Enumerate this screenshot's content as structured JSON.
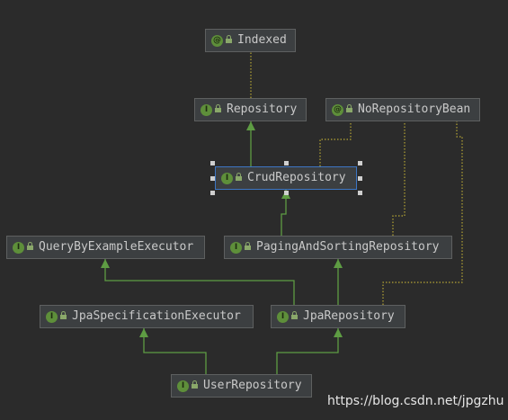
{
  "nodes": {
    "indexed": {
      "label": "Indexed",
      "kind": "@"
    },
    "repository": {
      "label": "Repository",
      "kind": "I"
    },
    "no_repository_bean": {
      "label": "NoRepositoryBean",
      "kind": "@"
    },
    "crud_repository": {
      "label": "CrudRepository",
      "kind": "I"
    },
    "query_by_example_executor": {
      "label": "QueryByExampleExecutor",
      "kind": "I"
    },
    "paging_and_sorting_repository": {
      "label": "PagingAndSortingRepository",
      "kind": "I"
    },
    "jpa_specification_executor": {
      "label": "JpaSpecificationExecutor",
      "kind": "I"
    },
    "jpa_repository": {
      "label": "JpaRepository",
      "kind": "I"
    },
    "user_repository": {
      "label": "UserRepository",
      "kind": "I"
    }
  },
  "edges": [
    {
      "from": "repository",
      "to": "indexed",
      "type": "annotation"
    },
    {
      "from": "crud_repository",
      "to": "repository",
      "type": "extends"
    },
    {
      "from": "crud_repository",
      "to": "no_repository_bean",
      "type": "annotation"
    },
    {
      "from": "paging_and_sorting_repository",
      "to": "crud_repository",
      "type": "extends"
    },
    {
      "from": "paging_and_sorting_repository",
      "to": "no_repository_bean",
      "type": "annotation"
    },
    {
      "from": "jpa_repository",
      "to": "paging_and_sorting_repository",
      "type": "extends"
    },
    {
      "from": "jpa_repository",
      "to": "query_by_example_executor",
      "type": "extends"
    },
    {
      "from": "jpa_repository",
      "to": "no_repository_bean",
      "type": "annotation"
    },
    {
      "from": "user_repository",
      "to": "jpa_repository",
      "type": "extends"
    },
    {
      "from": "user_repository",
      "to": "jpa_specification_executor",
      "type": "extends"
    }
  ],
  "selected": "crud_repository",
  "colors": {
    "background": "#2b2b2b",
    "node_fill": "#3c3f41",
    "node_border": "#5e6060",
    "extends_arrow": "#5e9c43",
    "annotation_line": "#b5a535",
    "selection": "#3d76c4"
  },
  "watermark": "https://blog.csdn.net/jpgzhu"
}
